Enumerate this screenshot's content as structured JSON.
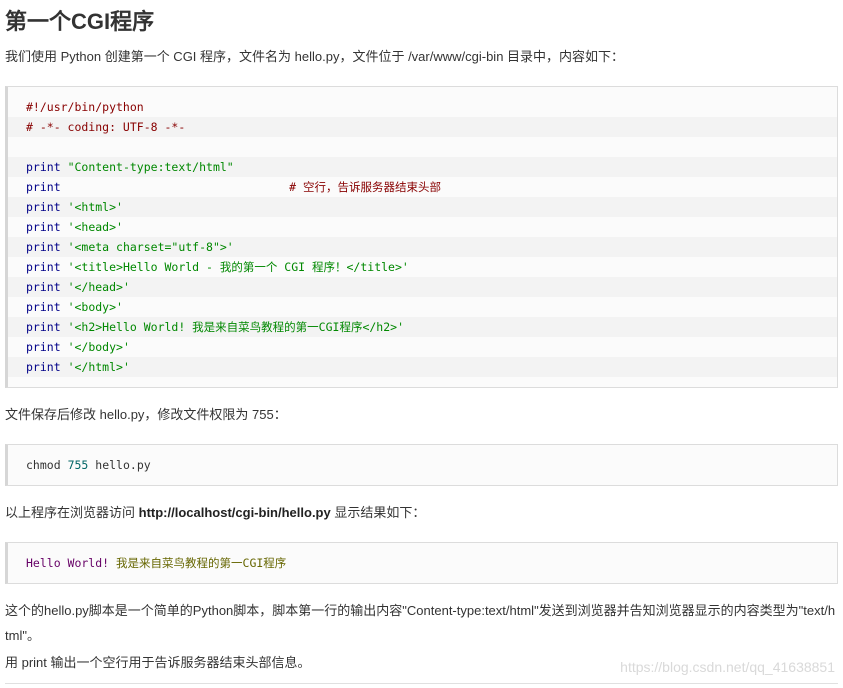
{
  "title": "第一个CGI程序",
  "intro": "我们使用 Python 创建第一个 CGI 程序，文件名为 hello.py，文件位于 /var/www/cgi-bin 目录中，内容如下：",
  "code1": {
    "l1": "#!/usr/bin/python",
    "l2": "# -*- coding: UTF-8 -*-",
    "l4_kw": "print",
    "l4_str": "\"Content-type:text/html\"",
    "l5_kw": "print",
    "l5_com": "# 空行，告诉服务器结束头部",
    "l6_kw": "print",
    "l6_str": "'<html>'",
    "l7_kw": "print",
    "l7_str": "'<head>'",
    "l8_kw": "print",
    "l8_str": "'<meta charset=\"utf-8\">'",
    "l9_kw": "print",
    "l9_str": "'<title>Hello World - 我的第一个 CGI 程序！</title>'",
    "l10_kw": "print",
    "l10_str": "'</head>'",
    "l11_kw": "print",
    "l11_str": "'<body>'",
    "l12_kw": "print",
    "l12_str": "'<h2>Hello World! 我是来自菜鸟教程的第一CGI程序</h2>'",
    "l13_kw": "print",
    "l13_str": "'</body>'",
    "l14_kw": "print",
    "l14_str": "'</html>'"
  },
  "para2": "文件保存后修改 hello.py，修改文件权限为 755：",
  "code2": {
    "cmd": "chmod",
    "num": "755",
    "file": "hello.py"
  },
  "para3": {
    "before": "以上程序在浏览器访问 ",
    "url": "http://localhost/cgi-bin/hello.py",
    "after": " 显示结果如下："
  },
  "code3": {
    "part1": "Hello World!",
    "part2": " 我是来自菜鸟教程的第一CGI程序"
  },
  "para4": "这个的hello.py脚本是一个简单的Python脚本，脚本第一行的输出内容\"Content-type:text/html\"发送到浏览器并告知浏览器显示的内容类型为\"text/html\"。",
  "para5": "用 print 输出一个空行用于告诉服务器结束头部信息。",
  "watermark": "https://blog.csdn.net/qq_41638851"
}
